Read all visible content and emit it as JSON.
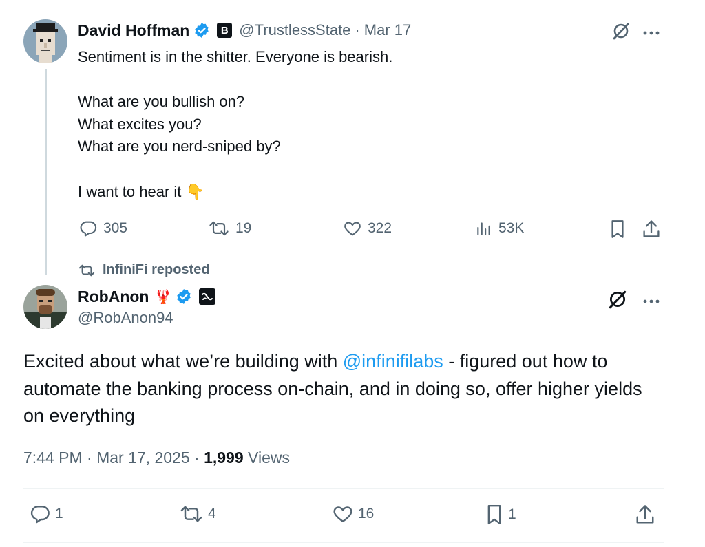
{
  "tweet1": {
    "author_name": "David Hoffman",
    "badge_letter": "B",
    "handle": "@TrustlessState",
    "separator": "·",
    "date": "Mar 17",
    "lines": [
      "Sentiment is in the shitter. Everyone is bearish.",
      "",
      "What are you bullish on?",
      "What excites you?",
      "What are you nerd-sniped by?",
      "",
      "I want to hear it 👇"
    ],
    "replies": "305",
    "reposts": "19",
    "likes": "322",
    "views": "53K"
  },
  "repost_label": "InfiniFi reposted",
  "tweet2": {
    "author_name": "RobAnon",
    "emoji": "🦞",
    "handle": "@RobAnon94",
    "text_before": "Excited about what we’re building with ",
    "mention": "@infinifilabs",
    "text_after": " - figured out how to automate the banking process on-chain, and in doing so, offer higher yields on everything",
    "time": "7:44 PM · Mar 17, 2025 · ",
    "views_count": "1,999",
    "views_label": " Views",
    "replies": "1",
    "reposts": "4",
    "likes": "16",
    "bookmarks": "1"
  },
  "colors": {
    "text": "#0f1419",
    "muted": "#536471",
    "link": "#1d9bf0",
    "verified": "#1d9bf0"
  }
}
